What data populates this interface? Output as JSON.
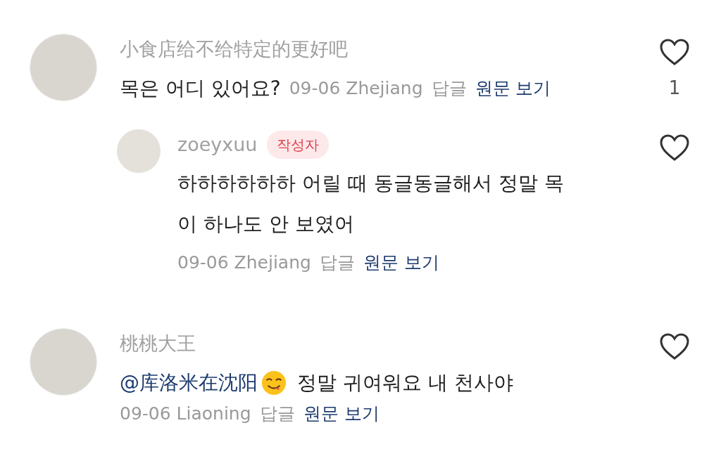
{
  "comments": [
    {
      "author": "小食店给不给特定的更好吧",
      "text": "목은 어디 있어요?",
      "date": "09-06",
      "location": "Zhejiang",
      "reply_label": "답글",
      "original_label": "원문 보기",
      "like_count": "1",
      "replies": [
        {
          "author": "zoeyxuu",
          "badge": "작성자",
          "text": "하하하하하하 어릴 때 동글동글해서 정말 목이 하나도 안 보였어",
          "date": "09-06",
          "location": "Zhejiang",
          "reply_label": "답글",
          "original_label": "원문 보기"
        }
      ]
    },
    {
      "author": "桃桃大王",
      "mention": "@库洛米在沈阳",
      "text": "정말 귀여워요 내 천사야",
      "date": "09-06",
      "location": "Liaoning",
      "reply_label": "답글",
      "original_label": "원문 보기"
    }
  ]
}
